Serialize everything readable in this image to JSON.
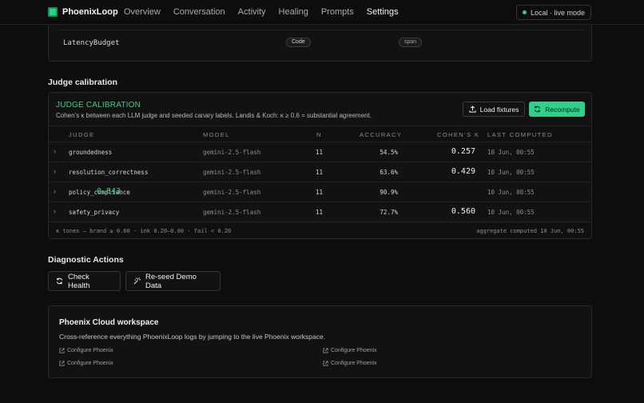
{
  "app": {
    "name": "PhoenixLoop",
    "mode": "Local · live mode"
  },
  "nav": [
    "Overview",
    "Conversation",
    "Activity",
    "Healing",
    "Prompts",
    "Settings"
  ],
  "nav_active": "Settings",
  "top_card": {
    "name": "LatencyBudget",
    "pill_1": "Code",
    "pill_2": "span"
  },
  "judge_section": {
    "heading": "Judge calibration"
  },
  "judge_card": {
    "title": "JUDGE CALIBRATION",
    "subtitle": "Cohen’s κ between each LLM judge and seeded canary labels. Landis & Koch: κ ≥ 0.6 = substantial agreement.",
    "load_button": "Load fixtures",
    "recompute_button": "Recompute",
    "columns": [
      "JUDGE",
      "MODEL",
      "N",
      "ACCURACY",
      "COHEN’S K",
      "LAST COMPUTED"
    ],
    "rows": [
      {
        "judge": "groundedness",
        "model": "gemini-2.5-flash",
        "n": "11",
        "accuracy": "54.5%",
        "kappa": "0.257",
        "computed": "10 Jun, 00:55"
      },
      {
        "judge": "resolution_correctness",
        "model": "gemini-2.5-flash",
        "n": "11",
        "accuracy": "63.6%",
        "kappa": "0.429",
        "computed": "10 Jun, 00:55"
      },
      {
        "judge": "policy_compliance",
        "model": "gemini-2.5-flash",
        "n": "11",
        "accuracy": "90.9%",
        "kappa": "0.843",
        "computed": "10 Jun, 00:55"
      },
      {
        "judge": "safety_privacy",
        "model": "gemini-2.5-flash",
        "n": "11",
        "accuracy": "72.7%",
        "kappa": "0.560",
        "computed": "10 Jun, 00:55"
      }
    ],
    "footer_left": "κ tones — brand ≥ 0.60 · ink 0.20–0.60 · fail < 0.20",
    "footer_right": "aggregate computed 10 Jun, 00:55"
  },
  "diagnostics": {
    "heading": "Diagnostic Actions",
    "check_health": "Check Health",
    "reseed": "Re-seed Demo Data"
  },
  "phoenix": {
    "title": "Phoenix Cloud workspace",
    "subtitle": "Cross-reference everything PhoenixLoop logs by jumping to the live Phoenix workspace.",
    "links": [
      "Configure Phoenix",
      "Configure Phoenix",
      "Configure Phoenix",
      "Configure Phoenix"
    ]
  },
  "colors": {
    "brand": "#2fd18a",
    "background": "#0c0d0c",
    "card": "#111211"
  }
}
